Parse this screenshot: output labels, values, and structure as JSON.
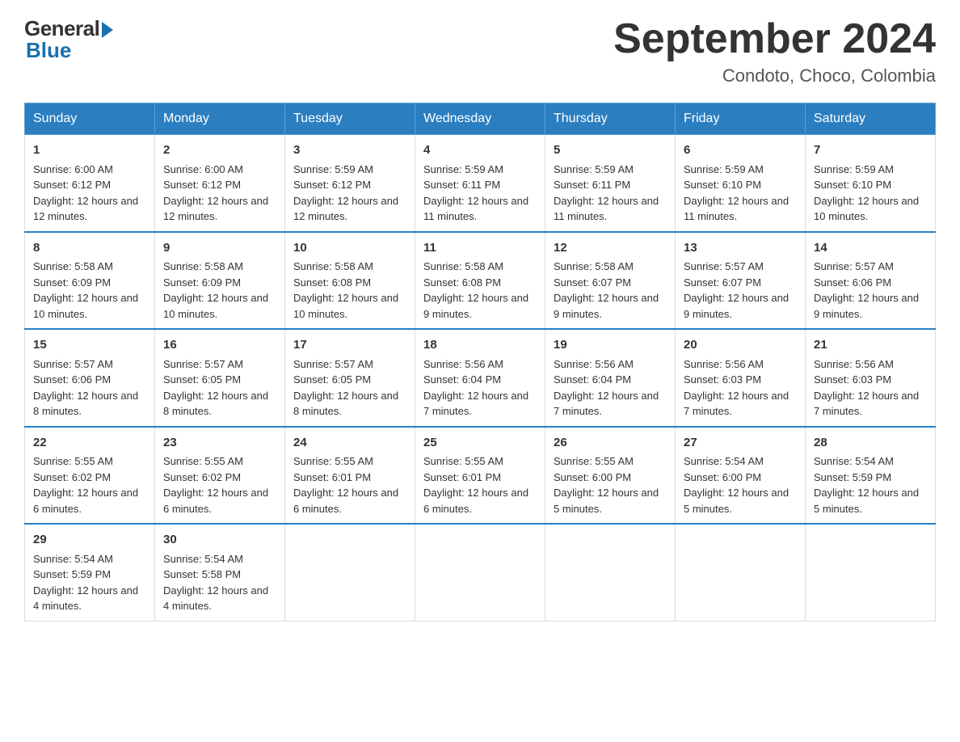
{
  "header": {
    "logo_general": "General",
    "logo_blue": "Blue",
    "month_title": "September 2024",
    "location": "Condoto, Choco, Colombia"
  },
  "days_of_week": [
    "Sunday",
    "Monday",
    "Tuesday",
    "Wednesday",
    "Thursday",
    "Friday",
    "Saturday"
  ],
  "weeks": [
    [
      {
        "day": "1",
        "sunrise": "6:00 AM",
        "sunset": "6:12 PM",
        "daylight": "12 hours and 12 minutes."
      },
      {
        "day": "2",
        "sunrise": "6:00 AM",
        "sunset": "6:12 PM",
        "daylight": "12 hours and 12 minutes."
      },
      {
        "day": "3",
        "sunrise": "5:59 AM",
        "sunset": "6:12 PM",
        "daylight": "12 hours and 12 minutes."
      },
      {
        "day": "4",
        "sunrise": "5:59 AM",
        "sunset": "6:11 PM",
        "daylight": "12 hours and 11 minutes."
      },
      {
        "day": "5",
        "sunrise": "5:59 AM",
        "sunset": "6:11 PM",
        "daylight": "12 hours and 11 minutes."
      },
      {
        "day": "6",
        "sunrise": "5:59 AM",
        "sunset": "6:10 PM",
        "daylight": "12 hours and 11 minutes."
      },
      {
        "day": "7",
        "sunrise": "5:59 AM",
        "sunset": "6:10 PM",
        "daylight": "12 hours and 10 minutes."
      }
    ],
    [
      {
        "day": "8",
        "sunrise": "5:58 AM",
        "sunset": "6:09 PM",
        "daylight": "12 hours and 10 minutes."
      },
      {
        "day": "9",
        "sunrise": "5:58 AM",
        "sunset": "6:09 PM",
        "daylight": "12 hours and 10 minutes."
      },
      {
        "day": "10",
        "sunrise": "5:58 AM",
        "sunset": "6:08 PM",
        "daylight": "12 hours and 10 minutes."
      },
      {
        "day": "11",
        "sunrise": "5:58 AM",
        "sunset": "6:08 PM",
        "daylight": "12 hours and 9 minutes."
      },
      {
        "day": "12",
        "sunrise": "5:58 AM",
        "sunset": "6:07 PM",
        "daylight": "12 hours and 9 minutes."
      },
      {
        "day": "13",
        "sunrise": "5:57 AM",
        "sunset": "6:07 PM",
        "daylight": "12 hours and 9 minutes."
      },
      {
        "day": "14",
        "sunrise": "5:57 AM",
        "sunset": "6:06 PM",
        "daylight": "12 hours and 9 minutes."
      }
    ],
    [
      {
        "day": "15",
        "sunrise": "5:57 AM",
        "sunset": "6:06 PM",
        "daylight": "12 hours and 8 minutes."
      },
      {
        "day": "16",
        "sunrise": "5:57 AM",
        "sunset": "6:05 PM",
        "daylight": "12 hours and 8 minutes."
      },
      {
        "day": "17",
        "sunrise": "5:57 AM",
        "sunset": "6:05 PM",
        "daylight": "12 hours and 8 minutes."
      },
      {
        "day": "18",
        "sunrise": "5:56 AM",
        "sunset": "6:04 PM",
        "daylight": "12 hours and 7 minutes."
      },
      {
        "day": "19",
        "sunrise": "5:56 AM",
        "sunset": "6:04 PM",
        "daylight": "12 hours and 7 minutes."
      },
      {
        "day": "20",
        "sunrise": "5:56 AM",
        "sunset": "6:03 PM",
        "daylight": "12 hours and 7 minutes."
      },
      {
        "day": "21",
        "sunrise": "5:56 AM",
        "sunset": "6:03 PM",
        "daylight": "12 hours and 7 minutes."
      }
    ],
    [
      {
        "day": "22",
        "sunrise": "5:55 AM",
        "sunset": "6:02 PM",
        "daylight": "12 hours and 6 minutes."
      },
      {
        "day": "23",
        "sunrise": "5:55 AM",
        "sunset": "6:02 PM",
        "daylight": "12 hours and 6 minutes."
      },
      {
        "day": "24",
        "sunrise": "5:55 AM",
        "sunset": "6:01 PM",
        "daylight": "12 hours and 6 minutes."
      },
      {
        "day": "25",
        "sunrise": "5:55 AM",
        "sunset": "6:01 PM",
        "daylight": "12 hours and 6 minutes."
      },
      {
        "day": "26",
        "sunrise": "5:55 AM",
        "sunset": "6:00 PM",
        "daylight": "12 hours and 5 minutes."
      },
      {
        "day": "27",
        "sunrise": "5:54 AM",
        "sunset": "6:00 PM",
        "daylight": "12 hours and 5 minutes."
      },
      {
        "day": "28",
        "sunrise": "5:54 AM",
        "sunset": "5:59 PM",
        "daylight": "12 hours and 5 minutes."
      }
    ],
    [
      {
        "day": "29",
        "sunrise": "5:54 AM",
        "sunset": "5:59 PM",
        "daylight": "12 hours and 4 minutes."
      },
      {
        "day": "30",
        "sunrise": "5:54 AM",
        "sunset": "5:58 PM",
        "daylight": "12 hours and 4 minutes."
      },
      null,
      null,
      null,
      null,
      null
    ]
  ]
}
